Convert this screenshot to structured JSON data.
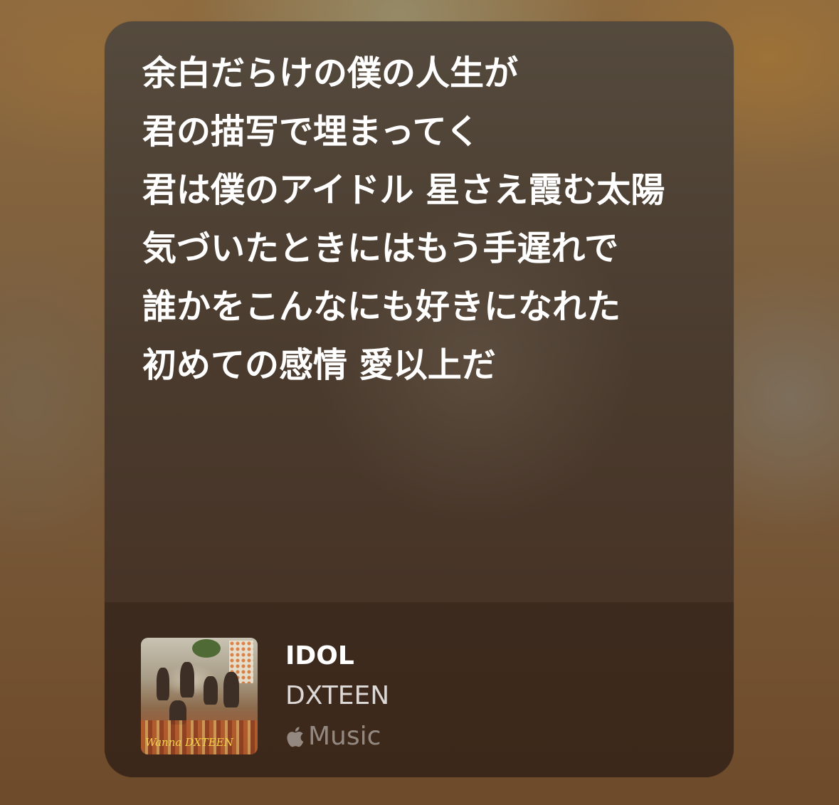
{
  "lyrics": {
    "lines": [
      "余白だらけの僕の人生が",
      "君の描写で埋まってく",
      "君は僕のアイドル 星さえ霞む太陽",
      "気づいたときにはもう手遅れで",
      "誰かをこんなにも好きになれた",
      "初めての感情 愛以上だ"
    ]
  },
  "track": {
    "title": "IDOL",
    "artist": "DXTEEN",
    "artwork_text": "Wanna DXTEEN"
  },
  "service": {
    "name": "Music",
    "icon": "apple-logo-icon"
  }
}
